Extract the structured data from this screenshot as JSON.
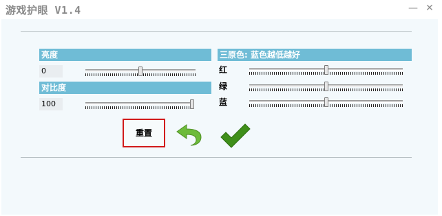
{
  "window": {
    "title": "游戏护眼 V1.4",
    "minimize_icon": "minimize-icon",
    "close_icon": "close-icon"
  },
  "brightness": {
    "header": "亮度",
    "value": "0",
    "level": 0.5
  },
  "contrast": {
    "header": "对比度",
    "value": "100",
    "level": 1.0
  },
  "primaries": {
    "header": "三原色: 蓝色越低越好",
    "channels": [
      {
        "label": "红",
        "level": 0.5
      },
      {
        "label": "绿",
        "level": 0.5
      },
      {
        "label": "蓝",
        "level": 0.5
      }
    ]
  },
  "actions": {
    "reset_label": "重置",
    "undo_icon": "undo-arrow-icon",
    "confirm_icon": "checkmark-icon"
  },
  "colors": {
    "section_bar": "#6fbcd6",
    "reset_outline": "#d11a1a",
    "undo_arrow": "#6dbb3a",
    "checkmark": "#3f8f1a"
  }
}
